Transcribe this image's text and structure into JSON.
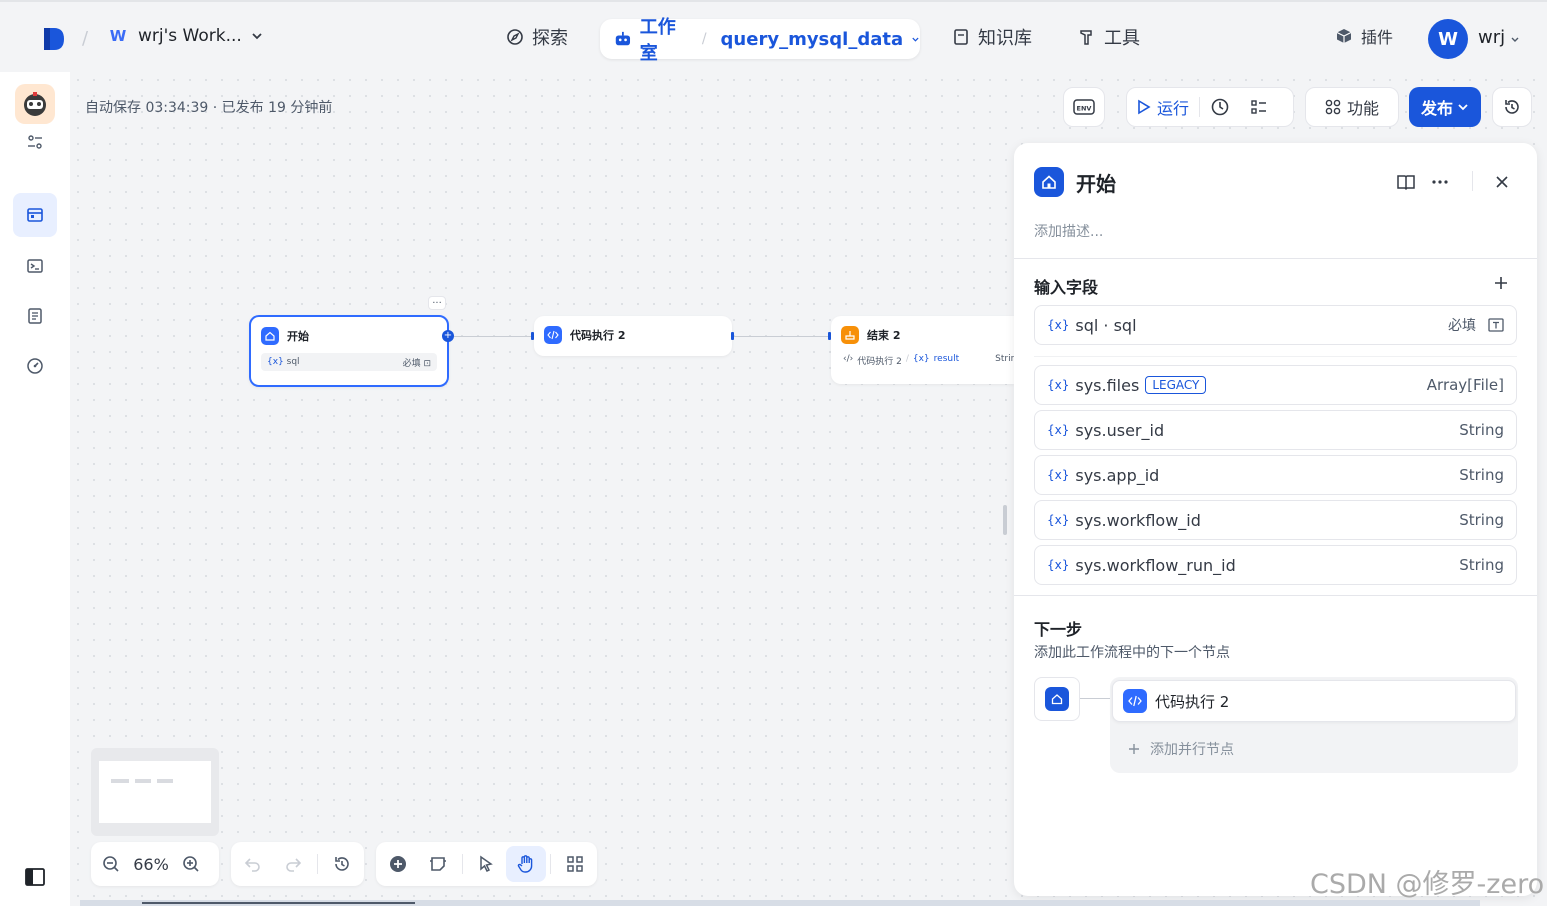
{
  "header": {
    "workspace_badge": "W",
    "workspace_name": "wrj's Work...",
    "nav_explore": "探索",
    "studio_label": "工作室",
    "app_name": "query_mysql_data",
    "nav_knowledge": "知识库",
    "nav_tools": "工具",
    "nav_plugins": "插件",
    "user_initial": "W",
    "user_name": "wrj"
  },
  "canvas": {
    "autosave": "自动保存 03:34:39 · 已发布 19 分钟前",
    "toolbar": {
      "env": "ENV",
      "run": "运行",
      "features": "功能",
      "publish": "发布"
    },
    "zoom": "66%"
  },
  "nodes": {
    "start": {
      "title": "开始",
      "var": "{x}",
      "field": "sql",
      "required": "必填"
    },
    "code": {
      "title": "代码执行 2"
    },
    "end": {
      "title": "结束 2",
      "src": "代码执行 2",
      "var": "{x}",
      "out": "result",
      "type": "String"
    }
  },
  "panel": {
    "title": "开始",
    "description_placeholder": "添加描述...",
    "input_title": "输入字段",
    "fields": [
      {
        "icon": "{x}",
        "name": "sql · sql",
        "meta": "必填"
      },
      {
        "icon": "{x}",
        "name": "sys.files",
        "badge": "LEGACY",
        "meta": "Array[File]"
      },
      {
        "icon": "{x}",
        "name": "sys.user_id",
        "meta": "String"
      },
      {
        "icon": "{x}",
        "name": "sys.app_id",
        "meta": "String"
      },
      {
        "icon": "{x}",
        "name": "sys.workflow_id",
        "meta": "String"
      },
      {
        "icon": "{x}",
        "name": "sys.workflow_run_id",
        "meta": "String"
      }
    ],
    "next_title": "下一步",
    "next_desc": "添加此工作流程中的下一个节点",
    "next_node": "代码执行 2",
    "add_parallel": "添加并行节点"
  },
  "watermark": "CSDN @修罗-zero",
  "colors": {
    "accent": "#1a56db",
    "end_node": "#f79009"
  }
}
